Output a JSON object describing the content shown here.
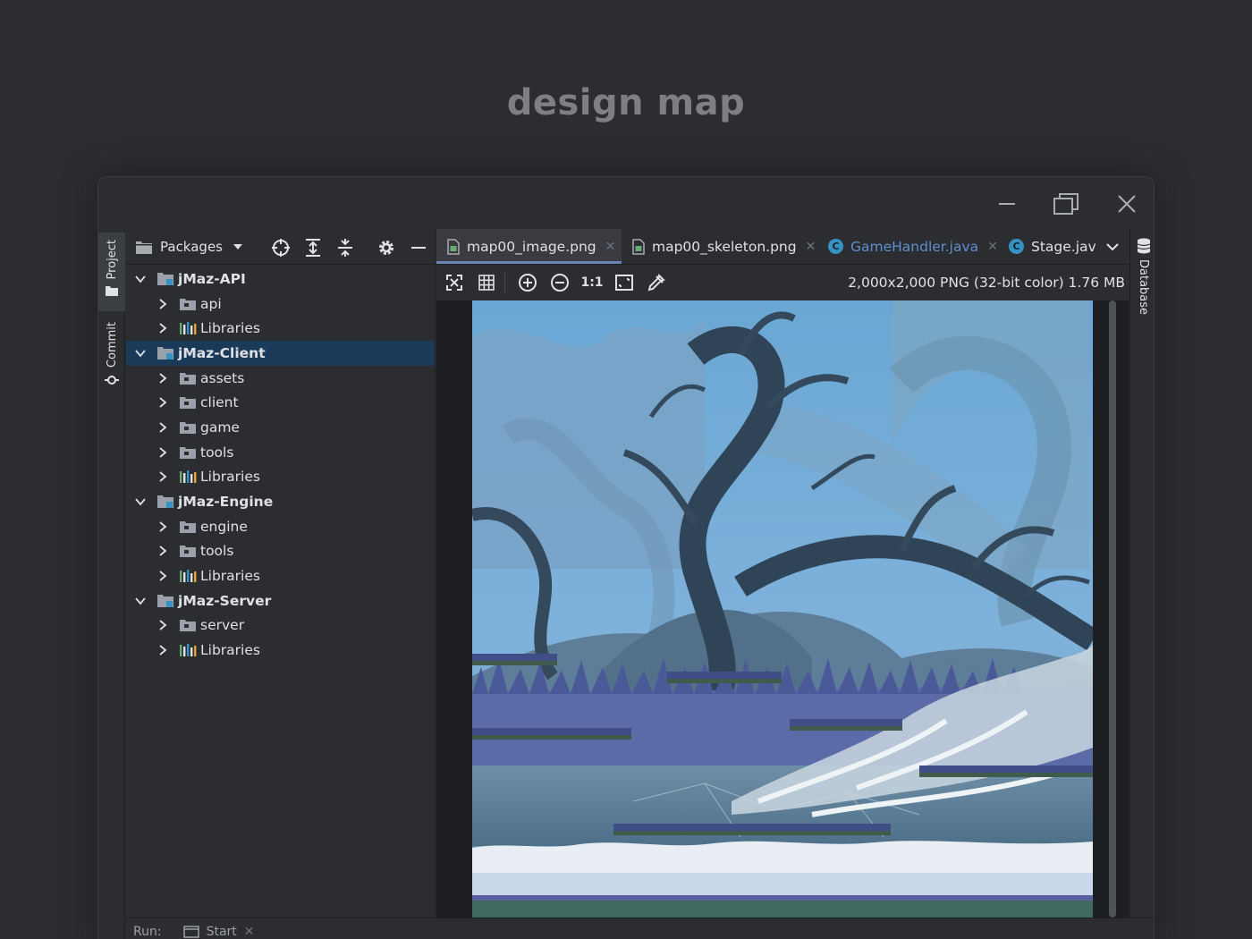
{
  "page": {
    "heading": "design map"
  },
  "window": {
    "controls": [
      "minimize",
      "restore",
      "close"
    ]
  },
  "tool_stripe": {
    "items": [
      {
        "label": "Project",
        "icon": "folder-icon",
        "active": true
      },
      {
        "label": "Commit",
        "icon": "commit-icon",
        "active": false
      }
    ]
  },
  "project_panel": {
    "view_selector": "Packages",
    "header_icons": [
      "locate-icon",
      "expand-all-icon",
      "collapse-all-icon",
      "gear-icon",
      "hide-icon"
    ],
    "tree": [
      {
        "label": "jMaz-API",
        "level": 0,
        "type": "module",
        "expanded": true,
        "selected": false
      },
      {
        "label": "api",
        "level": 1,
        "type": "package",
        "expanded": false,
        "selected": false
      },
      {
        "label": "Libraries",
        "level": 1,
        "type": "libraries",
        "expanded": false,
        "selected": false
      },
      {
        "label": "jMaz-Client",
        "level": 0,
        "type": "module",
        "expanded": true,
        "selected": true
      },
      {
        "label": "assets",
        "level": 1,
        "type": "package",
        "expanded": false,
        "selected": false
      },
      {
        "label": "client",
        "level": 1,
        "type": "package",
        "expanded": false,
        "selected": false
      },
      {
        "label": "game",
        "level": 1,
        "type": "package",
        "expanded": false,
        "selected": false
      },
      {
        "label": "tools",
        "level": 1,
        "type": "package",
        "expanded": false,
        "selected": false
      },
      {
        "label": "Libraries",
        "level": 1,
        "type": "libraries",
        "expanded": false,
        "selected": false
      },
      {
        "label": "jMaz-Engine",
        "level": 0,
        "type": "module",
        "expanded": true,
        "selected": false
      },
      {
        "label": "engine",
        "level": 1,
        "type": "package",
        "expanded": false,
        "selected": false
      },
      {
        "label": "tools",
        "level": 1,
        "type": "package",
        "expanded": false,
        "selected": false
      },
      {
        "label": "Libraries",
        "level": 1,
        "type": "libraries",
        "expanded": false,
        "selected": false
      },
      {
        "label": "jMaz-Server",
        "level": 0,
        "type": "module",
        "expanded": true,
        "selected": false
      },
      {
        "label": "server",
        "level": 1,
        "type": "package",
        "expanded": false,
        "selected": false
      },
      {
        "label": "Libraries",
        "level": 1,
        "type": "libraries",
        "expanded": false,
        "selected": false
      }
    ]
  },
  "editor": {
    "tabs": [
      {
        "label": "map00_image.png",
        "type": "image",
        "active": true,
        "closable": true
      },
      {
        "label": "map00_skeleton.png",
        "type": "image",
        "active": false,
        "closable": true
      },
      {
        "label": "GameHandler.java",
        "type": "class",
        "active": false,
        "closable": true,
        "color": "#5f8fd0"
      },
      {
        "label": "Stage.jav",
        "type": "class",
        "active": false,
        "closable": false
      }
    ],
    "class_badge_letter": "C",
    "image_toolbar_icons": [
      "fit-icon",
      "grid-icon",
      "zoom-in-icon",
      "zoom-out-icon",
      "actual-size-icon",
      "fit-window-icon",
      "color-picker-icon"
    ],
    "actual_size_label": "1:1",
    "image_info": "2,000x2,000 PNG (32-bit color) 1.76 MB"
  },
  "right_stripe": {
    "label": "Database",
    "icon": "database-icon"
  },
  "bottom_bar": {
    "run_label": "Run:",
    "config_label": "Start"
  },
  "colors": {
    "background": "#2b2d30",
    "selection": "#1b3a5a",
    "accent": "#6a85b5",
    "class_icon": "#3592c4"
  }
}
